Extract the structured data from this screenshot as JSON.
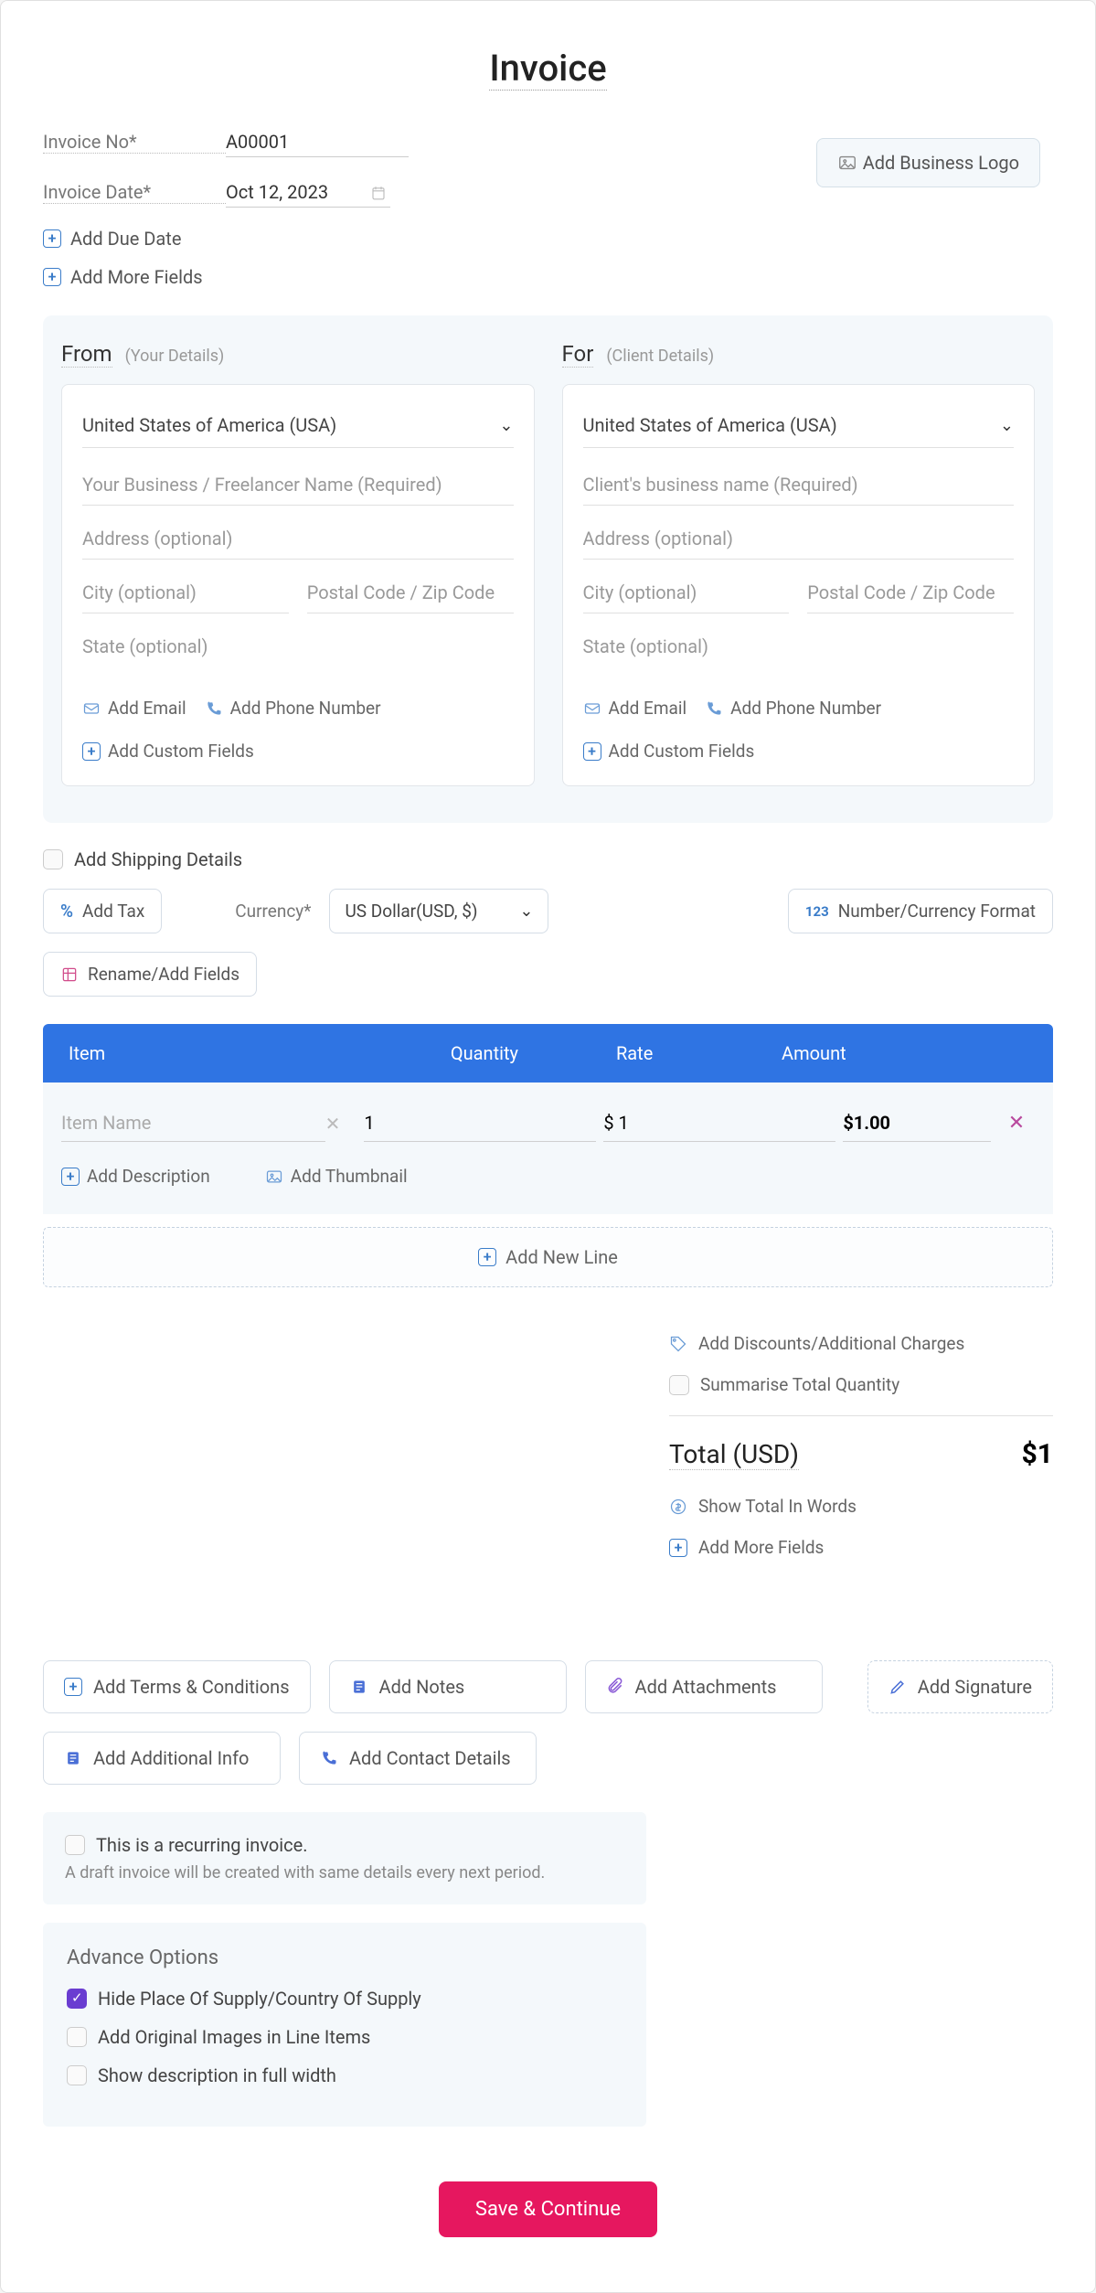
{
  "title": "Invoice",
  "meta": {
    "invoice_no_label": "Invoice No*",
    "invoice_no_value": "A00001",
    "invoice_date_label": "Invoice Date*",
    "invoice_date_value": "Oct 12, 2023",
    "add_due_date": "Add Due Date",
    "add_more_fields": "Add More Fields"
  },
  "logo_btn": "Add Business Logo",
  "from": {
    "title": "From",
    "sub": "(Your Details)",
    "country": "United States of America (USA)",
    "name_ph": "Your Business / Freelancer Name (Required)",
    "addr_ph": "Address (optional)",
    "city_ph": "City (optional)",
    "zip_ph": "Postal Code / Zip Code",
    "state_ph": "State (optional)",
    "add_email": "Add Email",
    "add_phone": "Add Phone Number",
    "add_custom": "Add Custom Fields"
  },
  "for": {
    "title": "For",
    "sub": "(Client Details)",
    "country": "United States of America (USA)",
    "name_ph": "Client's business name (Required)",
    "addr_ph": "Address (optional)",
    "city_ph": "City (optional)",
    "zip_ph": "Postal Code / Zip Code",
    "state_ph": "State (optional)",
    "add_email": "Add Email",
    "add_phone": "Add Phone Number",
    "add_custom": "Add Custom Fields"
  },
  "shipping": "Add Shipping Details",
  "toolbar": {
    "add_tax": "Add Tax",
    "currency_label": "Currency*",
    "currency_value": "US Dollar(USD, $)",
    "num_format": "Number/Currency Format",
    "rename": "Rename/Add Fields"
  },
  "table": {
    "h_item": "Item",
    "h_qty": "Quantity",
    "h_rate": "Rate",
    "h_amt": "Amount",
    "row": {
      "name_ph": "Item Name",
      "qty": "1",
      "rate": "$ 1",
      "amount": "$1.00"
    },
    "add_desc": "Add Description",
    "add_thumb": "Add Thumbnail",
    "add_line": "Add New Line"
  },
  "summary": {
    "discounts": "Add Discounts/Additional Charges",
    "summarise": "Summarise Total Quantity",
    "total_label": "Total (USD)",
    "total_value": "$1",
    "show_words": "Show Total In Words",
    "add_more": "Add More Fields"
  },
  "actions": {
    "terms": "Add Terms & Conditions",
    "notes": "Add Notes",
    "attach": "Add Attachments",
    "signature": "Add Signature",
    "additional": "Add Additional Info",
    "contact": "Add Contact Details"
  },
  "recurring": {
    "label": "This is a recurring invoice.",
    "note": "A draft invoice will be created with same details every next period."
  },
  "advance": {
    "title": "Advance Options",
    "opt1": "Hide Place Of Supply/Country Of Supply",
    "opt2": "Add Original Images in Line Items",
    "opt3": "Show description in full width"
  },
  "save": "Save & Continue"
}
